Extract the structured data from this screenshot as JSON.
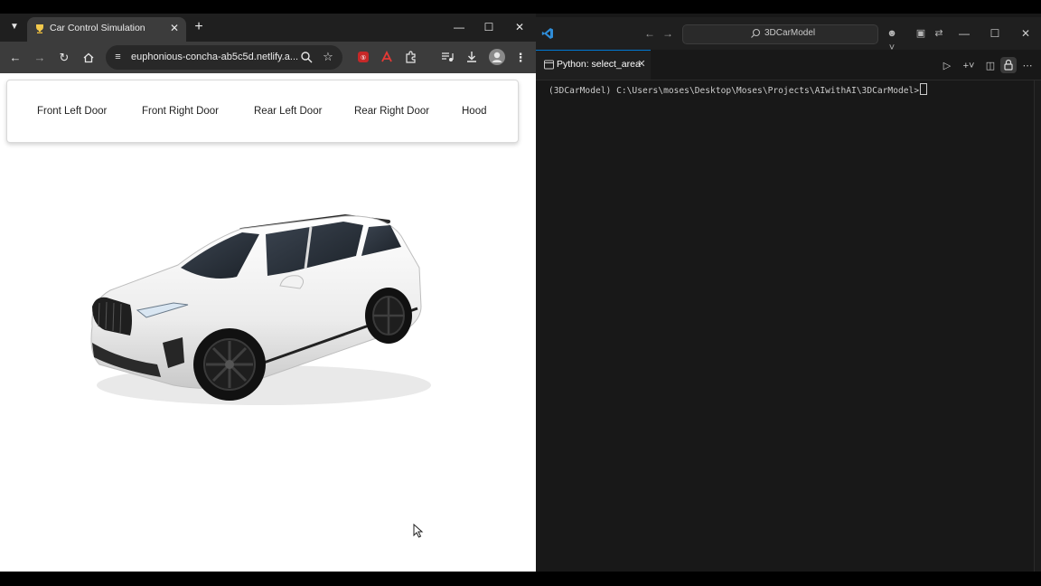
{
  "browser": {
    "tab": {
      "title": "Car Control Simulation",
      "favicon": "trophy-icon"
    },
    "url": "euphonious-concha-ab5c5d.netlify.a...",
    "icons": {
      "tab_search": "chevron-down-icon",
      "new_tab": "plus-icon",
      "back": "arrow-left-icon",
      "forward": "arrow-right-icon",
      "reload": "reload-icon",
      "home": "home-icon",
      "zoom": "magnifier-icon",
      "bookmark": "star-icon",
      "extensions": "puzzle-icon",
      "downloads": "download-icon",
      "menu": "kebab-menu-icon"
    }
  },
  "page": {
    "controls": [
      {
        "label": "Front Left Door"
      },
      {
        "label": "Front Right Door"
      },
      {
        "label": "Rear Left Door"
      },
      {
        "label": "Rear Right Door"
      },
      {
        "label": "Hood"
      }
    ]
  },
  "vscode": {
    "command_center": "3DCarModel",
    "tab_label": "Python: select_area",
    "terminal_line": "(3DCarModel) C:\\Users\\moses\\Desktop\\Moses\\Projects\\AIwithAI\\3DCarModel>",
    "accent": "#0078d4"
  }
}
